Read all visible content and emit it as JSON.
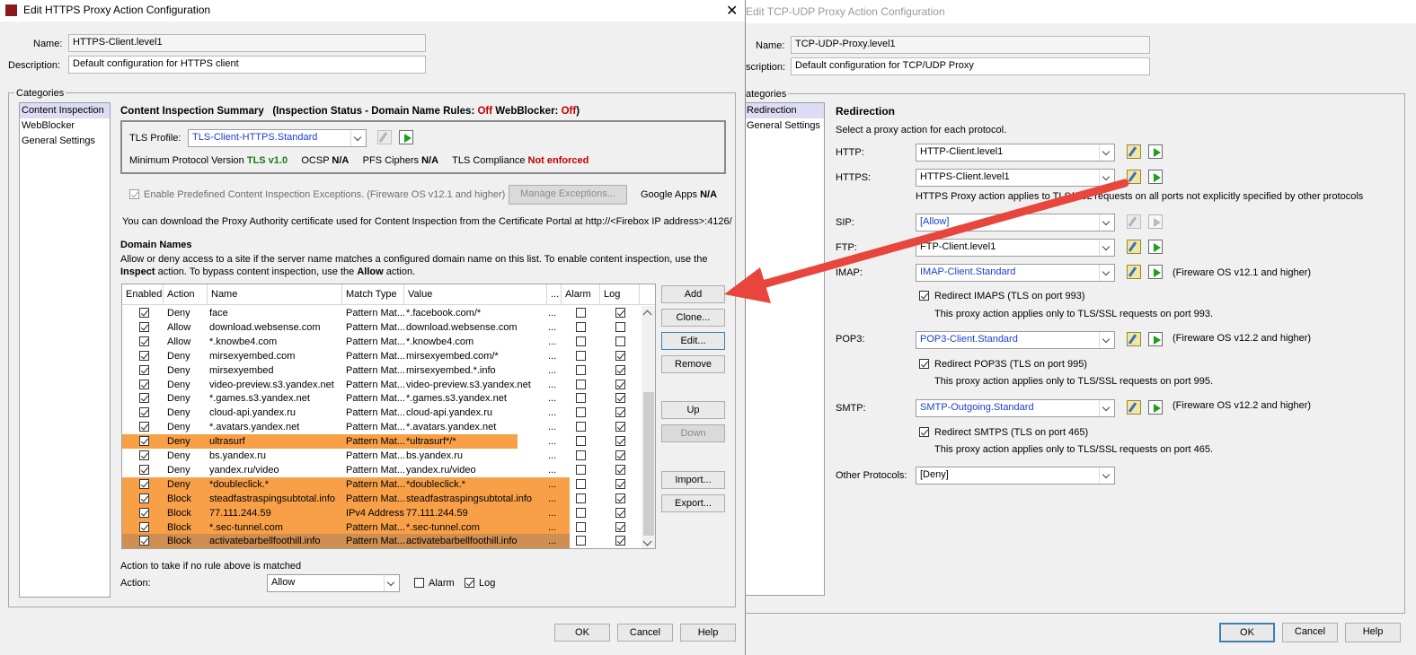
{
  "left_window": {
    "title": "Edit HTTPS Proxy Action Configuration",
    "name_label": "Name:",
    "name_value": "HTTPS-Client.level1",
    "desc_label": "Description:",
    "desc_value": "Default configuration for HTTPS client",
    "categories_label": "Categories",
    "categories": [
      "Content Inspection",
      "WebBlocker",
      "General Settings"
    ],
    "summary": {
      "title": "Content Inspection Summary",
      "status_prefix": "(Inspection Status  -  Domain Name Rules:",
      "domain_rules_value": "Off",
      "webblocker_label": "WebBlocker:",
      "webblocker_value": "Off",
      "close_paren": ")",
      "tls_profile_label": "TLS Profile:",
      "tls_profile_value": "TLS-Client-HTTPS.Standard",
      "min_proto_label": "Minimum Protocol Version",
      "min_proto_value": "TLS v1.0",
      "ocsp_label": "OCSP",
      "ocsp_value": "N/A",
      "pfs_label": "PFS Ciphers",
      "pfs_value": "N/A",
      "compliance_label": "TLS Compliance",
      "compliance_value": "Not enforced"
    },
    "exceptions_label": "Enable Predefined Content Inspection Exceptions. (Fireware OS v12.1 and higher)",
    "manage_exceptions": "Manage Exceptions...",
    "google_apps_label": "Google Apps",
    "google_apps_value": "N/A",
    "cert_text": "You can download the Proxy Authority certificate used for Content Inspection from the Certificate Portal at http://<Firebox IP address>:4126/",
    "domain_names_title": "Domain Names",
    "domain_desc_1": "Allow or deny access to a site if the server name matches a configured domain name on this list. To enable content inspection, use the",
    "domain_desc_2a": "Inspect",
    "domain_desc_2b": " action. To bypass content inspection, use the ",
    "domain_desc_2c": "Allow",
    "domain_desc_2d": " action.",
    "columns": [
      "Enabled",
      "Action",
      "Name",
      "Match Type",
      "Value",
      "...",
      "Alarm",
      "Log"
    ],
    "rows": [
      {
        "enabled": true,
        "action": "Deny",
        "name": "face",
        "match": "Pattern Mat...",
        "value": "*.facebook.com/*",
        "dots": "...",
        "alarm": false,
        "log": true,
        "style": ""
      },
      {
        "enabled": true,
        "action": "Allow",
        "name": "download.websense.com",
        "match": "Pattern Mat...",
        "value": "download.websense.com",
        "dots": "...",
        "alarm": false,
        "log": false,
        "style": ""
      },
      {
        "enabled": true,
        "action": "Allow",
        "name": "*.knowbe4.com",
        "match": "Pattern Mat...",
        "value": "*.knowbe4.com",
        "dots": "...",
        "alarm": false,
        "log": false,
        "style": ""
      },
      {
        "enabled": true,
        "action": "Deny",
        "name": "mirsexyembed.com",
        "match": "Pattern Mat...",
        "value": "mirsexyembed.com/*",
        "dots": "...",
        "alarm": false,
        "log": true,
        "style": ""
      },
      {
        "enabled": true,
        "action": "Deny",
        "name": "mirsexyembed",
        "match": "Pattern Mat...",
        "value": "mirsexyembed.*.info",
        "dots": "...",
        "alarm": false,
        "log": true,
        "style": ""
      },
      {
        "enabled": true,
        "action": "Deny",
        "name": "video-preview.s3.yandex.net",
        "match": "Pattern Mat...",
        "value": "video-preview.s3.yandex.net",
        "dots": "...",
        "alarm": false,
        "log": true,
        "style": ""
      },
      {
        "enabled": true,
        "action": "Deny",
        "name": "*.games.s3.yandex.net",
        "match": "Pattern Mat...",
        "value": "*.games.s3.yandex.net",
        "dots": "...",
        "alarm": false,
        "log": true,
        "style": ""
      },
      {
        "enabled": true,
        "action": "Deny",
        "name": "cloud-api.yandex.ru",
        "match": "Pattern Mat...",
        "value": "cloud-api.yandex.ru",
        "dots": "...",
        "alarm": false,
        "log": true,
        "style": ""
      },
      {
        "enabled": true,
        "action": "Deny",
        "name": "*.avatars.yandex.net",
        "match": "Pattern Mat...",
        "value": "*.avatars.yandex.net",
        "dots": "...",
        "alarm": false,
        "log": true,
        "style": ""
      },
      {
        "enabled": true,
        "action": "Deny",
        "name": "ultrasurf",
        "match": "Pattern Mat...",
        "value": "*ultrasurf*/*",
        "dots": "...",
        "alarm": false,
        "log": true,
        "style": "hl"
      },
      {
        "enabled": true,
        "action": "Deny",
        "name": "bs.yandex.ru",
        "match": "Pattern Mat...",
        "value": "bs.yandex.ru",
        "dots": "...",
        "alarm": false,
        "log": true,
        "style": ""
      },
      {
        "enabled": true,
        "action": "Deny",
        "name": "yandex.ru/video",
        "match": "Pattern Mat...",
        "value": "yandex.ru/video",
        "dots": "...",
        "alarm": false,
        "log": true,
        "style": ""
      },
      {
        "enabled": true,
        "action": "Deny",
        "name": "*doubleclick.*",
        "match": "Pattern Mat...",
        "value": "*doubleclick.*",
        "dots": "...",
        "alarm": false,
        "log": true,
        "style": "hl"
      },
      {
        "enabled": true,
        "action": "Block",
        "name": "steadfastraspingsubtotal.info",
        "match": "Pattern Mat...",
        "value": "steadfastraspingsubtotal.info",
        "dots": "...",
        "alarm": false,
        "log": true,
        "style": "hl"
      },
      {
        "enabled": true,
        "action": "Block",
        "name": "77.111.244.59",
        "match": "IPv4 Address",
        "value": "77.111.244.59",
        "dots": "...",
        "alarm": false,
        "log": true,
        "style": "hl"
      },
      {
        "enabled": true,
        "action": "Block",
        "name": "*.sec-tunnel.com",
        "match": "Pattern Mat...",
        "value": "*.sec-tunnel.com",
        "dots": "...",
        "alarm": false,
        "log": true,
        "style": "hl"
      },
      {
        "enabled": true,
        "action": "Block",
        "name": "activatebarbellfoothill.info",
        "match": "Pattern Mat...",
        "value": "activatebarbellfoothill.info",
        "dots": "...",
        "alarm": false,
        "log": true,
        "style": "sel"
      }
    ],
    "side_buttons": [
      "Add",
      "Clone...",
      "Edit...",
      "Remove",
      "Up",
      "Down",
      "Import...",
      "Export..."
    ],
    "no_match_label": "Action to take if no rule above is matched",
    "action_label": "Action:",
    "action_value": "Allow",
    "alarm_label": "Alarm",
    "log_label": "Log",
    "ok": "OK",
    "cancel": "Cancel",
    "help": "Help"
  },
  "right_window": {
    "title": "Edit TCP-UDP Proxy Action Configuration",
    "name_label": "Name:",
    "name_value": "TCP-UDP-Proxy.level1",
    "desc_label": "scription:",
    "desc_value": "Default configuration for TCP/UDP Proxy",
    "categories_label": "ategories",
    "categories": [
      "Redirection",
      "General Settings"
    ],
    "redirection_title": "Redirection",
    "redirection_desc": "Select a proxy action for each protocol.",
    "http_label": "HTTP:",
    "http_value": "HTTP-Client.level1",
    "https_label": "HTTPS:",
    "https_value": "HTTPS-Client.level1",
    "https_note": "HTTPS Proxy action applies to TLS/SSL requests on all ports not explicitly specified by other protocols",
    "sip_label": "SIP:",
    "sip_value": "[Allow]",
    "ftp_label": "FTP:",
    "ftp_value": "FTP-Client.level1",
    "imap_label": "IMAP:",
    "imap_value": "IMAP-Client.Standard",
    "imap_note": "(Fireware OS v12.1 and higher)",
    "imaps_label": "Redirect IMAPS (TLS on port 993)",
    "imaps_desc": "This proxy action applies only to TLS/SSL requests on port 993.",
    "pop3_label": "POP3:",
    "pop3_value": "POP3-Client.Standard",
    "pop3_note": "(Fireware OS v12.2 and higher)",
    "pop3s_label": "Redirect POP3S (TLS on port 995)",
    "pop3s_desc": "This proxy action applies only to TLS/SSL requests on port 995.",
    "smtp_label": "SMTP:",
    "smtp_value": "SMTP-Outgoing.Standard",
    "smtp_note": "(Fireware OS v12.2 and higher)",
    "smtps_label": "Redirect SMTPS (TLS on port 465)",
    "smtps_desc": "This proxy action applies only to TLS/SSL requests on port 465.",
    "other_label": "Other Protocols:",
    "other_value": "[Deny]",
    "ok": "OK",
    "cancel": "Cancel",
    "help": "Help"
  },
  "colors": {
    "highlight_orange": "#f8a048",
    "selected_row": "#cf8e52",
    "arrow_red": "#e8453c",
    "status_red": "#c00000",
    "status_green": "#1a7a1a"
  }
}
